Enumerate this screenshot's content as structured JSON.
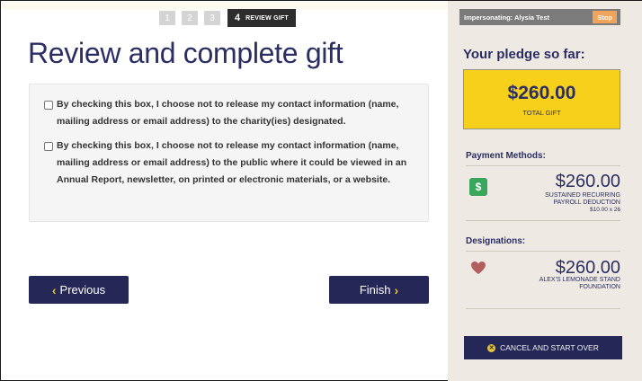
{
  "stepper": {
    "steps": [
      "1",
      "2",
      "3"
    ],
    "active_number": "4",
    "active_label": "REVIEW GIFT"
  },
  "page": {
    "title": "Review and complete gift"
  },
  "optouts": [
    {
      "text": "By checking this box, I choose not to release my contact information (name, mailing address or email address) to the charity(ies) designated.",
      "checked": false
    },
    {
      "text": "By checking this box, I choose not to release my contact information (name, mailing address or email address) to the public where it could be viewed in an Annual Report, newsletter, on printed or electronic materials, or a website.",
      "checked": false
    }
  ],
  "nav": {
    "previous_label": "Previous",
    "finish_label": "Finish"
  },
  "sidebar": {
    "impersonating_text": "Impersonating: Alysia Test",
    "stop_label": "Stop",
    "pledge_title": "Your pledge so far:",
    "total_amount": "$260.00",
    "total_label": "TOTAL GIFT",
    "payment_heading": "Payment Methods:",
    "payment_amount": "$260.00",
    "payment_type_line1": "SUSTAINED RECURRING",
    "payment_type_line2": "PAYROLL DEDUCTION",
    "payment_detail": "$10.00 x 26",
    "designations_heading": "Designations:",
    "designation_amount": "$260.00",
    "designation_line1": "ALEX'S LEMONADE STAND",
    "designation_line2": "FOUNDATION",
    "cancel_label": "CANCEL AND START OVER"
  },
  "colors": {
    "brand_navy": "#252856",
    "title_navy": "#2a2e63",
    "total_yellow": "#f6d01b",
    "accent_gold": "#e6c53b",
    "payment_green": "#38a65b",
    "heart_red": "#b35e5e",
    "stop_orange": "#f0a35a",
    "sidebar_bg": "#eeeae3"
  },
  "icons": {
    "payment": "dollar-icon",
    "designation": "heart-icon",
    "previous": "chevron-left-icon",
    "finish": "chevron-right-icon",
    "cancel": "x-circle-icon"
  }
}
